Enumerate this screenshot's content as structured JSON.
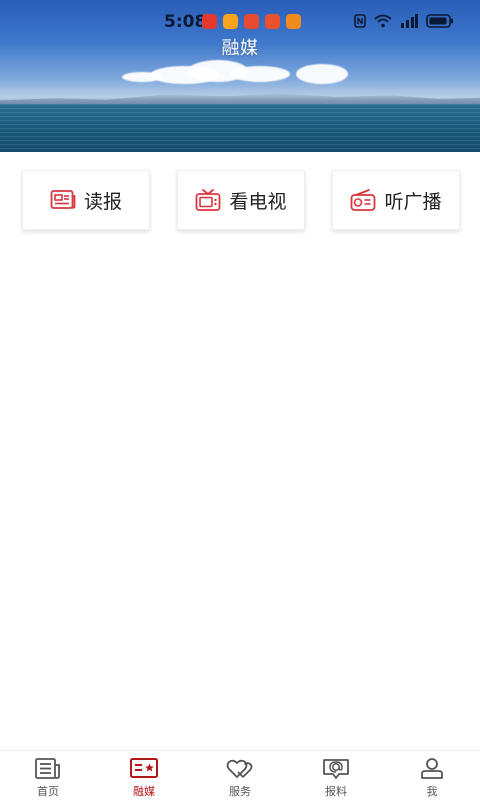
{
  "status_bar": {
    "time": "5:08",
    "app_icons": [
      {
        "name": "app-icon-1",
        "color": "#e5382e"
      },
      {
        "name": "app-icon-2",
        "color": "#f6a51d"
      },
      {
        "name": "app-icon-3",
        "color": "#e84a2f"
      },
      {
        "name": "app-icon-4",
        "color": "#e9512f"
      },
      {
        "name": "app-icon-5",
        "color": "#f28b1f"
      }
    ],
    "system_icons": [
      "nfc-icon",
      "wifi-icon",
      "signal-icon",
      "battery-icon"
    ]
  },
  "header": {
    "title": "融媒"
  },
  "media_buttons": [
    {
      "label": "读报",
      "icon": "newspaper-icon"
    },
    {
      "label": "看电视",
      "icon": "tv-icon"
    },
    {
      "label": "听广播",
      "icon": "radio-icon"
    }
  ],
  "bottom_nav": {
    "items": [
      {
        "label": "首页",
        "icon": "home-news-icon",
        "active": false
      },
      {
        "label": "融媒",
        "icon": "media-card-icon",
        "active": true
      },
      {
        "label": "服务",
        "icon": "hearts-service-icon",
        "active": false
      },
      {
        "label": "报料",
        "icon": "report-chat-icon",
        "active": false
      },
      {
        "label": "我",
        "icon": "user-icon",
        "active": false
      }
    ]
  },
  "colors": {
    "accent": "#b7151a",
    "icon_red": "#d9363e",
    "nav_gray": "#555555"
  }
}
